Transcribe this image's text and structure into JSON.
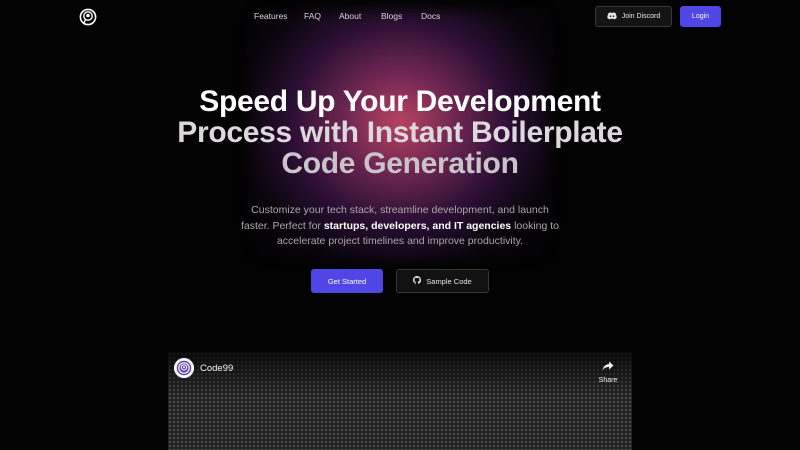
{
  "nav": {
    "links": [
      "Features",
      "FAQ",
      "About",
      "Blogs",
      "Docs"
    ],
    "discord_label": "Join Discord",
    "login_label": "Login"
  },
  "hero": {
    "title_line1": "Speed Up Your Development",
    "title_line2": "Process with Instant Boilerplate",
    "title_line3": "Code Generation",
    "subtitle_part1": "Customize your tech stack, streamline development, and launch faster. Perfect for ",
    "subtitle_bold": "startups, developers, and IT agencies",
    "subtitle_part2": " looking to accelerate project timelines and improve productivity.",
    "get_started_label": "Get Started",
    "sample_code_label": "Sample Code"
  },
  "video": {
    "channel_name": "Code99",
    "share_label": "Share"
  },
  "colors": {
    "accent": "#5046e5",
    "background": "#030303",
    "glow": "#c44868"
  },
  "icons": {
    "logo": "code99-logo-icon",
    "discord": "discord-icon",
    "github": "github-icon",
    "share": "share-arrow-icon"
  }
}
